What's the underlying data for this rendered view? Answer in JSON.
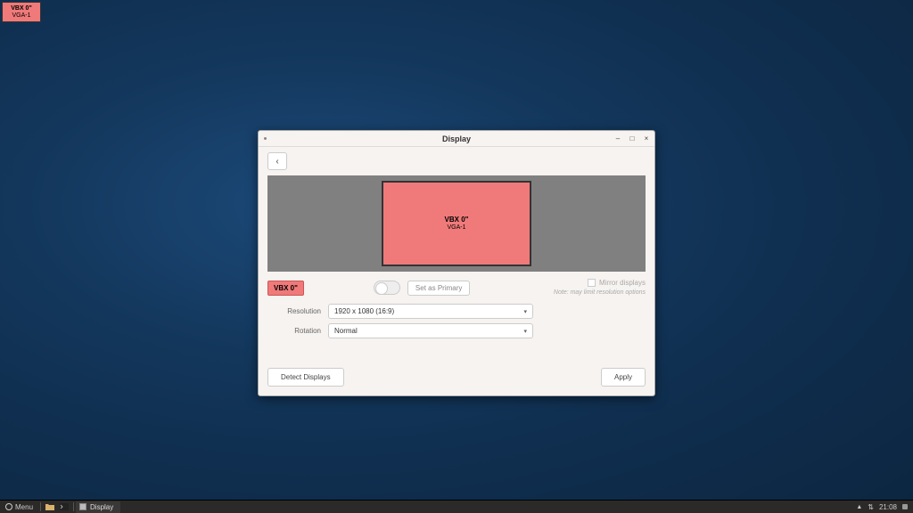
{
  "overlay": {
    "line1": "VBX 0\"",
    "line2": "VGA-1"
  },
  "window": {
    "title": "Display",
    "back_aria": "Back",
    "preview": {
      "name": "VBX 0\"",
      "connector": "VGA-1"
    },
    "display_tag": "VBX 0\"",
    "set_primary": "Set as Primary",
    "mirror_label": "Mirror displays",
    "mirror_note": "Note: may limit resolution options",
    "resolution_label": "Resolution",
    "resolution_value": "1920 x 1080 (16:9)",
    "rotation_label": "Rotation",
    "rotation_value": "Normal",
    "detect": "Detect Displays",
    "apply": "Apply"
  },
  "taskbar": {
    "menu": "Menu",
    "task": "Display",
    "time": "21:08"
  }
}
